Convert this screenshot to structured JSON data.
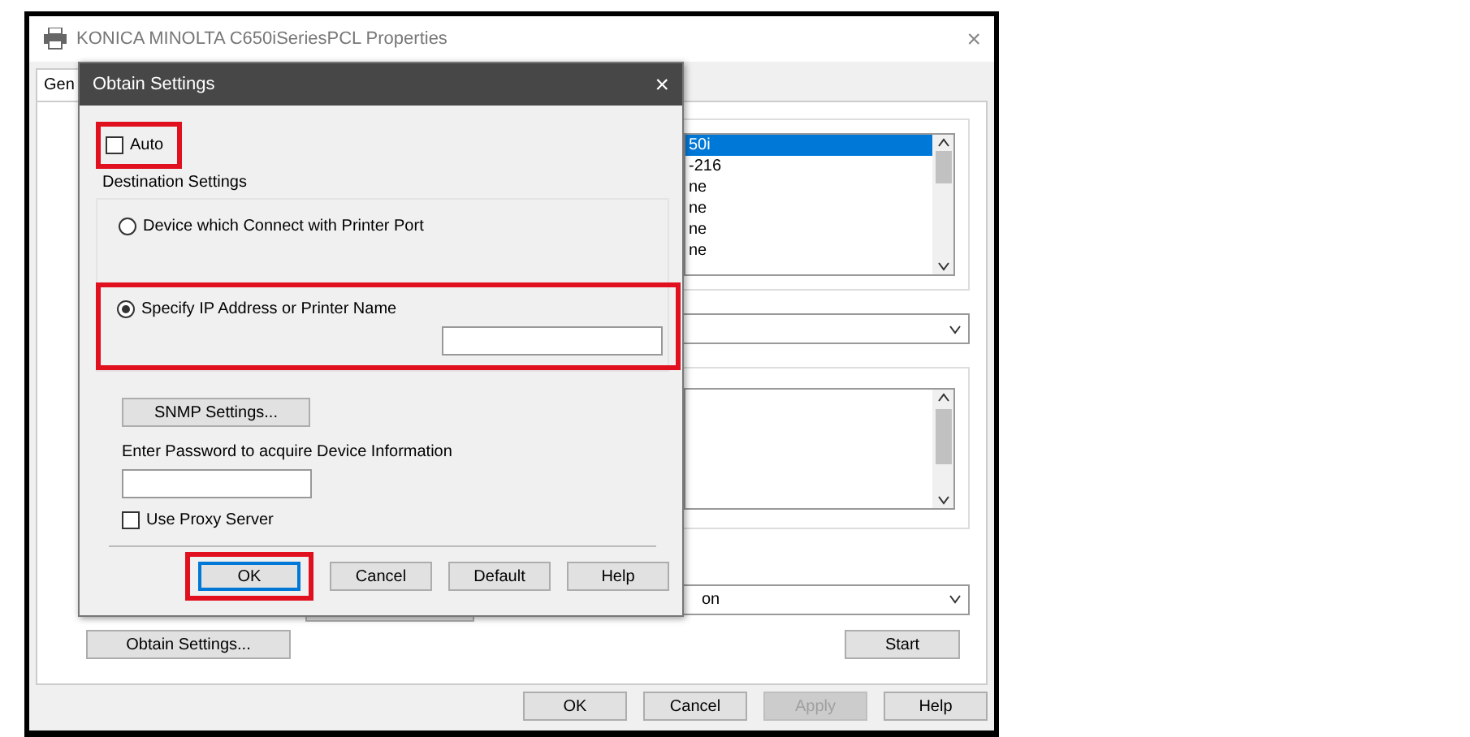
{
  "window": {
    "title": "KONICA MINOLTA C650iSeriesPCL Properties",
    "close": "×"
  },
  "tabs": [
    {
      "label": "Gen",
      "selected": true
    }
  ],
  "printer_list": {
    "items": [
      {
        "label": "50i",
        "selected": true
      },
      {
        "label": "-216",
        "selected": false
      },
      {
        "label": "ne",
        "selected": false
      },
      {
        "label": "ne",
        "selected": false
      },
      {
        "label": "ne",
        "selected": false
      },
      {
        "label": "ne",
        "selected": false
      }
    ]
  },
  "model_dropdown": {
    "value": "on"
  },
  "buttons": [
    {
      "label": "Obtain Settings..."
    },
    {
      "label": "Start"
    }
  ],
  "footer_buttons": [
    {
      "label": "OK",
      "disabled": false
    },
    {
      "label": "Cancel",
      "disabled": false
    },
    {
      "label": "Apply",
      "disabled": true
    },
    {
      "label": "Help",
      "disabled": false
    }
  ],
  "dialog": {
    "title": "Obtain Settings",
    "close": "×",
    "auto": {
      "label": "Auto",
      "checked": false,
      "highlighted": true
    },
    "group_label": "Destination Settings",
    "options": [
      {
        "kind": "radio",
        "label": "Device which Connect with Printer Port",
        "selected": false,
        "highlighted": false
      },
      {
        "kind": "radio_field",
        "label": "Specify IP Address or Printer Name",
        "selected": true,
        "highlighted": true
      }
    ],
    "snmp_button": "SNMP Settings...",
    "password_label": "Enter Password to acquire Device Information",
    "proxy": {
      "label": "Use Proxy Server",
      "checked": false
    },
    "buttons": [
      {
        "label": "OK",
        "default": true,
        "highlighted": true
      },
      {
        "label": "Cancel",
        "default": false,
        "highlighted": false
      },
      {
        "label": "Default",
        "default": false,
        "highlighted": false
      },
      {
        "label": "Help",
        "default": false,
        "highlighted": false
      }
    ]
  }
}
